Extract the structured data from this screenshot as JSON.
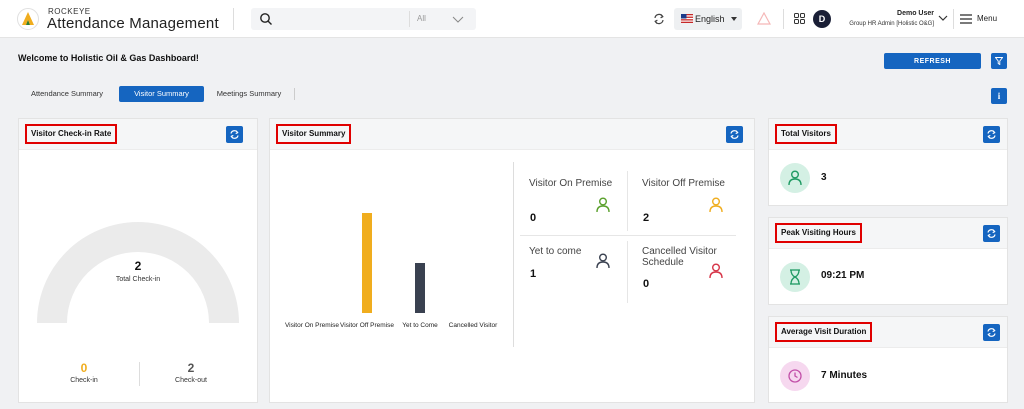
{
  "app": {
    "brand_small": "ROCKEYE",
    "brand_title": "Attendance Management"
  },
  "search": {
    "placeholder": "",
    "scope": "All"
  },
  "language": {
    "selected": "English"
  },
  "user": {
    "initial": "D",
    "name": "Demo User",
    "role": "Group HR Admin [Holistic O&G]"
  },
  "menu": {
    "label": "Menu"
  },
  "page": {
    "welcome": "Welcome to Holistic Oil & Gas Dashboard!",
    "refresh_label": "REFRESH",
    "info_label": "i"
  },
  "tabs": [
    {
      "label": "Attendance Summary",
      "active": false
    },
    {
      "label": "Visitor Summary",
      "active": true
    },
    {
      "label": "Meetings Summary",
      "active": false
    }
  ],
  "checkin_card": {
    "title": "Visitor Check-in Rate",
    "total_value": "2",
    "total_label": "Total Check-in",
    "checkin_value": "0",
    "checkin_label": "Check-in",
    "checkout_value": "2",
    "checkout_label": "Check-out",
    "gauge_fraction": 0.0
  },
  "visitor_card": {
    "title": "Visitor Summary",
    "stats": [
      {
        "label": "Visitor On Premise",
        "value": "0",
        "icon": "person-green-icon"
      },
      {
        "label": "Visitor Off Premise",
        "value": "2",
        "icon": "person-yellow-icon"
      },
      {
        "label": "Yet to come",
        "value": "1",
        "icon": "person-dark-icon"
      },
      {
        "label": "Cancelled Visitor Schedule",
        "value": "0",
        "icon": "person-red-icon"
      }
    ]
  },
  "chart_data": {
    "type": "bar",
    "categories": [
      "Visitor On Premise",
      "Visitor Off Premise",
      "Yet to Come",
      "Cancelled Visitor"
    ],
    "values": [
      0,
      2,
      1,
      0
    ],
    "colors": [
      "#5aa02c",
      "#f0ad1e",
      "#3a4150",
      "#d63447"
    ],
    "ylim": [
      0,
      2
    ]
  },
  "total_visitors": {
    "title": "Total Visitors",
    "value": "3"
  },
  "peak_hours": {
    "title": "Peak Visiting Hours",
    "value": "09:21 PM"
  },
  "avg_duration": {
    "title": "Average Visit Duration",
    "value": "7 Minutes"
  },
  "colors": {
    "primary": "#1565c0",
    "highlight_border": "#e00000",
    "green": "#5aa02c",
    "yellow": "#f0ad1e",
    "dark": "#3a4150",
    "red": "#d63447"
  }
}
